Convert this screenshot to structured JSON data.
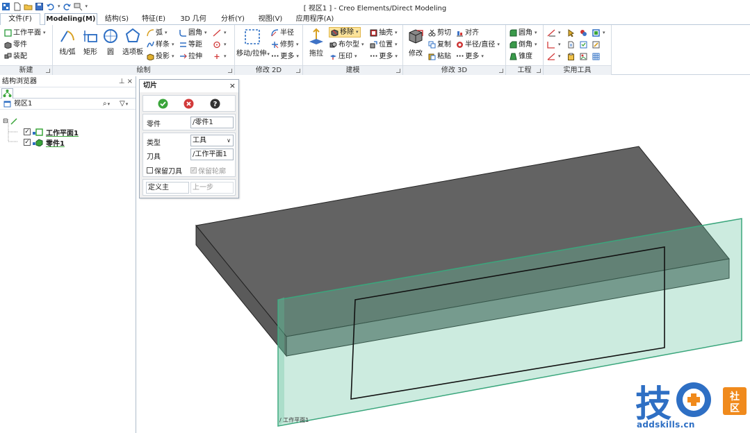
{
  "window": {
    "title": "[ 视区1 ] - Creo Elements/Direct Modeling"
  },
  "menu": {
    "tabs": [
      {
        "label": "文件(F)"
      },
      {
        "label": "Modeling(M)"
      },
      {
        "label": "结构(S)"
      },
      {
        "label": "特征(E)"
      },
      {
        "label": "3D 几何"
      },
      {
        "label": "分析(Y)"
      },
      {
        "label": "视图(V)"
      },
      {
        "label": "应用程序(A)"
      }
    ]
  },
  "ribbon": {
    "new": {
      "group": "新建",
      "items": [
        "工作平面",
        "零件",
        "装配"
      ]
    },
    "draw": {
      "group": "绘制",
      "line_arc": "线/弧",
      "rect": "矩形",
      "circle": "圆",
      "options": "选项板",
      "arc": "弧",
      "fillet": "圆角",
      "spline": "样条",
      "offset": "等距",
      "project": "投影",
      "extend": "拉伸"
    },
    "modify2d": {
      "group": "修改 2D",
      "move_stretch": "移动/拉伸",
      "radius": "半径",
      "trim": "修剪",
      "more": "更多"
    },
    "model": {
      "group": "建模",
      "pull": "拖拉",
      "remove": "移除",
      "shell": "抽壳",
      "boolean": "布尔型",
      "position": "位置",
      "imprint": "压印",
      "more": "更多"
    },
    "modify3d": {
      "group": "修改 3D",
      "modify": "修改",
      "cut": "剪切",
      "align": "对齐",
      "copy": "复制",
      "radius_dia": "半径/直径",
      "paste": "粘贴",
      "more": "更多"
    },
    "eng": {
      "group": "工程",
      "fillet": "圆角",
      "chamfer": "倒角",
      "taper": "锥度"
    },
    "util": {
      "group": "实用工具"
    }
  },
  "browser": {
    "title": "结构浏览器",
    "view": "视区1",
    "items": [
      {
        "label": "工作平面1"
      },
      {
        "label": "零件1"
      }
    ]
  },
  "dialog": {
    "title": "切片",
    "part_label": "零件",
    "part_value": "/零件1",
    "type_label": "类型",
    "type_value": "工具",
    "tool_label": "刀具",
    "tool_value": "/工作平面1",
    "keep_tool": "保留刀具",
    "keep_profile": "保留轮廓",
    "define_main": "定义主",
    "prev_step": "上一步"
  },
  "viewport": {
    "workplane_label": "/ 工作平面1"
  },
  "watermark": {
    "text": "addskills.cn",
    "logo_chars": "技",
    "corner_top": "社",
    "corner_bottom": "区"
  },
  "colors": {
    "accent": "#2e6fc4",
    "confirm": "#3aa53a",
    "cancel": "#d23a3a",
    "plane": "#5fc09a",
    "solid_top": "#636363"
  }
}
